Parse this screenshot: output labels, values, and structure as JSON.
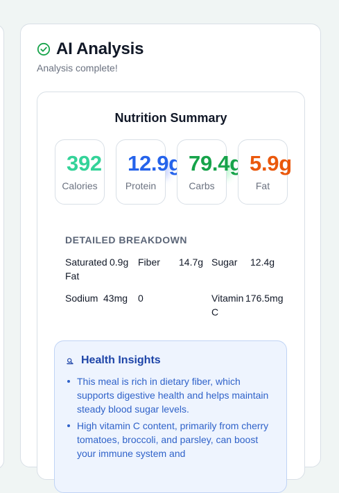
{
  "header": {
    "title": "AI Analysis",
    "subtitle": "Analysis complete!"
  },
  "summary": {
    "title": "Nutrition Summary",
    "stats": [
      {
        "value": "392",
        "label": "Calories",
        "color": "#34d399"
      },
      {
        "value": "12.9g",
        "label": "Protein",
        "color": "#2563eb"
      },
      {
        "value": "79.4g",
        "label": "Carbs",
        "color": "#16a34a"
      },
      {
        "value": "5.9g",
        "label": "Fat",
        "color": "#ea580c"
      }
    ]
  },
  "breakdown": {
    "title": "DETAILED BREAKDOWN",
    "items": [
      {
        "name": "Saturated Fat",
        "value": "0.9g"
      },
      {
        "name": "Fiber",
        "value": "14.7g"
      },
      {
        "name": "Sugar",
        "value": "12.4g"
      },
      {
        "name": "Sodium",
        "value": "43mg"
      },
      {
        "name": "",
        "value": "0"
      },
      {
        "name": "Vitamin C",
        "value": "176.5mg"
      }
    ]
  },
  "insights": {
    "title": "Health Insights",
    "items": [
      "This meal is rich in dietary fiber, which supports digestive health and helps maintain steady blood sugar levels.",
      "High vitamin C content, primarily from cherry tomatoes, broccoli, and parsley, can boost your immune system and"
    ]
  },
  "icons": {
    "check": "check-circle-icon",
    "insights": "brain-icon"
  },
  "colors": {
    "accent": "#16a34a",
    "insight_text": "#2f62c9",
    "insight_title": "#1e45a8"
  }
}
